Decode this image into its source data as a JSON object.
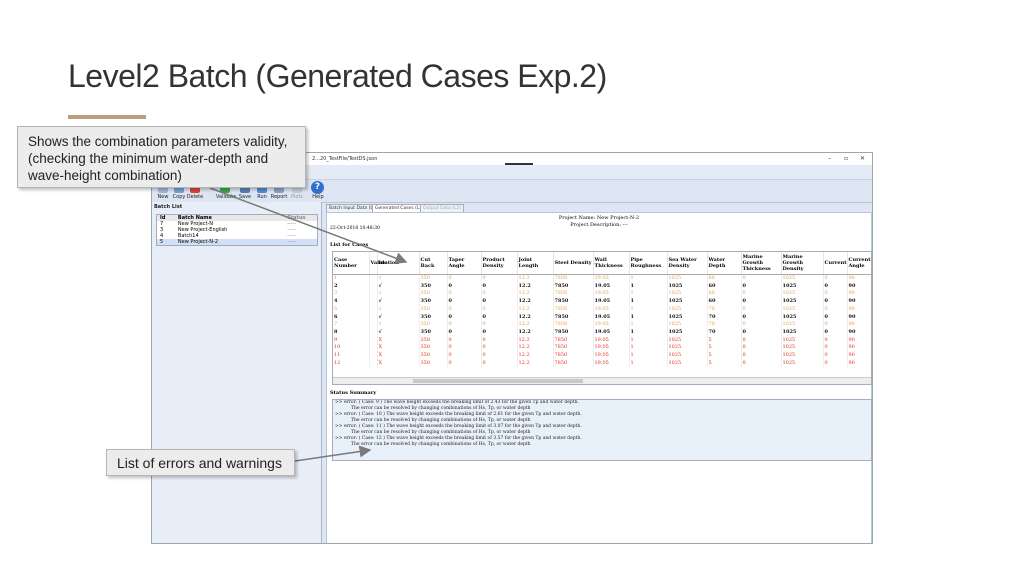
{
  "slide": {
    "title": "Level2 Batch (Generated Cases Exp.2)"
  },
  "app": {
    "window_path": "2...20_TestFile/TestDS.json",
    "window_controls": [
      "–",
      "▫",
      "✕"
    ],
    "toolbar": [
      {
        "label": "New",
        "icon": "new-icon"
      },
      {
        "label": "Copy",
        "icon": "copy-icon"
      },
      {
        "label": "Delete",
        "icon": "delete-icon"
      },
      {
        "label": "Validate",
        "icon": "validate-icon"
      },
      {
        "label": "Save",
        "icon": "save-icon"
      },
      {
        "label": "Run",
        "icon": "run-icon"
      },
      {
        "label": "Report",
        "icon": "report-icon"
      },
      {
        "label": "Plots",
        "icon": "plots-icon"
      },
      {
        "label": "Help",
        "icon": "help-icon"
      }
    ],
    "batch_list": {
      "title": "Batch List",
      "headers": [
        "Id",
        "Batch Name",
        "Status"
      ],
      "rows": [
        {
          "id": "7",
          "name": "New Project-N",
          "status": "-----"
        },
        {
          "id": "3",
          "name": "New Project-English",
          "status": "-----"
        },
        {
          "id": "4",
          "name": "Batch14",
          "status": "-----"
        },
        {
          "id": "5",
          "name": "New Project-N-2",
          "status": "-----"
        }
      ]
    },
    "tabs": [
      {
        "label": "Batch Input Data (L2)",
        "state": "normal"
      },
      {
        "label": "Generated Cases (L2)",
        "state": "active"
      },
      {
        "label": "Output Data (L2)",
        "state": "disabled"
      }
    ],
    "project_name": "Project Name: New Project-N-2",
    "project_description": "Project Description: ---",
    "datetime": "22-Oct-2018 10:48:30",
    "list_title": "List for Cases",
    "table": {
      "headers": [
        "Case Number",
        "Validation",
        "inc",
        "Cut Back",
        "Taper Angle",
        "Product Density",
        "Joint Length",
        "Steel Density",
        "Wall Thickness",
        "Pipe Roughness",
        "Sea Water Density",
        "Water Depth",
        "Marine Growth Thickness",
        "Marine Growth Density",
        "Current",
        "Current Angle"
      ],
      "rows": [
        {
          "style": "orange",
          "cells": [
            "1",
            "",
            "√",
            "350",
            "0",
            "0",
            "12.2",
            "7850",
            "19.05",
            "1",
            "1025",
            "60",
            "0",
            "1025",
            "0",
            "90"
          ]
        },
        {
          "style": "dark",
          "cells": [
            "2",
            "",
            "√",
            "350",
            "0",
            "0",
            "12.2",
            "7850",
            "19.05",
            "1",
            "1025",
            "60",
            "0",
            "1025",
            "0",
            "90"
          ]
        },
        {
          "style": "orange",
          "cells": [
            "3",
            "",
            "√",
            "350",
            "0",
            "0",
            "12.2",
            "7850",
            "19.05",
            "1",
            "1025",
            "60",
            "0",
            "1025",
            "0",
            "90"
          ]
        },
        {
          "style": "dark",
          "cells": [
            "4",
            "",
            "√",
            "350",
            "0",
            "0",
            "12.2",
            "7850",
            "19.05",
            "1",
            "1025",
            "60",
            "0",
            "1025",
            "0",
            "90"
          ]
        },
        {
          "style": "orange",
          "cells": [
            "5",
            "",
            "√",
            "350",
            "0",
            "0",
            "12.2",
            "7850",
            "19.05",
            "1",
            "1025",
            "70",
            "0",
            "1025",
            "0",
            "90"
          ]
        },
        {
          "style": "dark",
          "cells": [
            "6",
            "",
            "√",
            "350",
            "0",
            "0",
            "12.2",
            "7850",
            "19.05",
            "1",
            "1025",
            "70",
            "0",
            "1025",
            "0",
            "90"
          ]
        },
        {
          "style": "orange",
          "cells": [
            "7",
            "",
            "√",
            "350",
            "0",
            "0",
            "12.2",
            "7850",
            "19.05",
            "1",
            "1025",
            "70",
            "0",
            "1025",
            "0",
            "90"
          ]
        },
        {
          "style": "dark",
          "cells": [
            "8",
            "",
            "√",
            "350",
            "0",
            "0",
            "12.2",
            "7850",
            "19.05",
            "1",
            "1025",
            "70",
            "0",
            "1025",
            "0",
            "90"
          ]
        },
        {
          "style": "red",
          "cells": [
            "9",
            "",
            "X",
            "350",
            "0",
            "0",
            "12.2",
            "7850",
            "19.05",
            "1",
            "1025",
            "5",
            "0",
            "1025",
            "0",
            "90"
          ]
        },
        {
          "style": "red",
          "cells": [
            "10",
            "",
            "X",
            "350",
            "0",
            "0",
            "12.2",
            "7850",
            "19.05",
            "1",
            "1025",
            "5",
            "0",
            "1025",
            "0",
            "90"
          ]
        },
        {
          "style": "red",
          "cells": [
            "11",
            "",
            "X",
            "350",
            "0",
            "0",
            "12.2",
            "7850",
            "19.05",
            "1",
            "1025",
            "5",
            "0",
            "1025",
            "0",
            "90"
          ]
        },
        {
          "style": "red",
          "cells": [
            "12",
            "",
            "X",
            "350",
            "0",
            "0",
            "12.2",
            "7850",
            "19.05",
            "1",
            "1025",
            "5",
            "0",
            "1025",
            "0",
            "90"
          ]
        }
      ]
    },
    "messages_title": "Status Summary",
    "messages": [
      {
        "indent": false,
        "text": ">> error: ( Case: 9 ) The wave height exceeds the breaking limit of 2.43 for the given Tp and water depth."
      },
      {
        "indent": true,
        "text": "The error can be resolved by changing combinations of Hs, Tp, or water depth"
      },
      {
        "indent": false,
        "text": ">> error: ( Case: 10 ) The wave height exceeds the breaking limit of 2.61 for the given Tp and water depth."
      },
      {
        "indent": true,
        "text": "The error can be resolved by changing combinations of Hs, Tp, or water depth"
      },
      {
        "indent": false,
        "text": ">> error: ( Case: 11 ) The wave height exceeds the breaking limit of 3.07 for the given Tp and water depth."
      },
      {
        "indent": true,
        "text": "The error can be resolved by changing combinations of Hs, Tp, or water depth"
      },
      {
        "indent": false,
        "text": ">> error: ( Case: 12 ) The wave height exceeds the breaking limit of 3.57 for the given Tp and water depth."
      },
      {
        "indent": true,
        "text": "The error can be resolved by changing combinations of Hs, Tp, or water depth"
      }
    ]
  },
  "callouts": {
    "validity": "Shows the combination parameters validity, (checking the minimum water-depth and wave-height combination)",
    "errors": "List of errors and warnings"
  },
  "colors": {
    "accent_rule": "#b8a07a",
    "row_dark": "#111111",
    "row_warning": "#e2a052",
    "row_error": "#e0301e",
    "help_blue": "#2f6fd0"
  }
}
